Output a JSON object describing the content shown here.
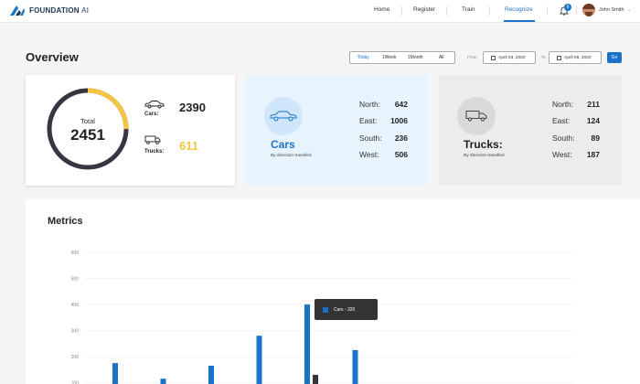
{
  "header": {
    "brand_name": "FOUNDATION",
    "brand_suffix": "AI",
    "nav": [
      {
        "label": "Home"
      },
      {
        "label": "Register"
      },
      {
        "label": "Train"
      },
      {
        "label": "Recognize",
        "active": true
      }
    ],
    "notifications_count": "6",
    "user_name": "John Smith",
    "accent_color": "#1a73c8"
  },
  "overview": {
    "title": "Overview",
    "periods": [
      "Today",
      "1Week",
      "1Month",
      "All"
    ],
    "selected_period": "Today",
    "from_label": "From",
    "from_date": "April 03, 2020",
    "to_label": "To",
    "to_date": "April 06, 2020",
    "go_label": "Go"
  },
  "total_card": {
    "label": "Total",
    "value": "2451",
    "cars_label": "Cars:",
    "cars_value": "2390",
    "trucks_label": "Trucks:",
    "trucks_value": "611",
    "ring_fraction": 0.25,
    "cars_color": "#3a3340",
    "trucks_color": "#f4c542"
  },
  "cars_card": {
    "title": "Cars",
    "subtitle": "By direction travelled",
    "icon": "car-icon",
    "directions": [
      {
        "label": "North:",
        "value": "642"
      },
      {
        "label": "East:",
        "value": "1006"
      },
      {
        "label": "South:",
        "value": "236"
      },
      {
        "label": "West:",
        "value": "506"
      }
    ]
  },
  "trucks_card": {
    "title": "Trucks:",
    "subtitle": "By direction travelled",
    "icon": "truck-icon",
    "directions": [
      {
        "label": "North:",
        "value": "211"
      },
      {
        "label": "East:",
        "value": "124"
      },
      {
        "label": "South:",
        "value": "89"
      },
      {
        "label": "West:",
        "value": "187"
      }
    ]
  },
  "metrics": {
    "title": "Metrics",
    "tooltip": "Cars - 320"
  },
  "chart_data": {
    "type": "bar",
    "title": "Metrics",
    "ylim": [
      0,
      600
    ],
    "yticks": [
      "100",
      "200",
      "300",
      "400",
      "500",
      "600"
    ],
    "grid": true,
    "series": [
      {
        "name": "Cars",
        "color": "#1a73c8",
        "values": [
          175,
          115,
          165,
          280,
          400,
          225
        ]
      },
      {
        "color": "#3a3340",
        "values": [
          null,
          null,
          null,
          null,
          130,
          null
        ]
      }
    ]
  }
}
